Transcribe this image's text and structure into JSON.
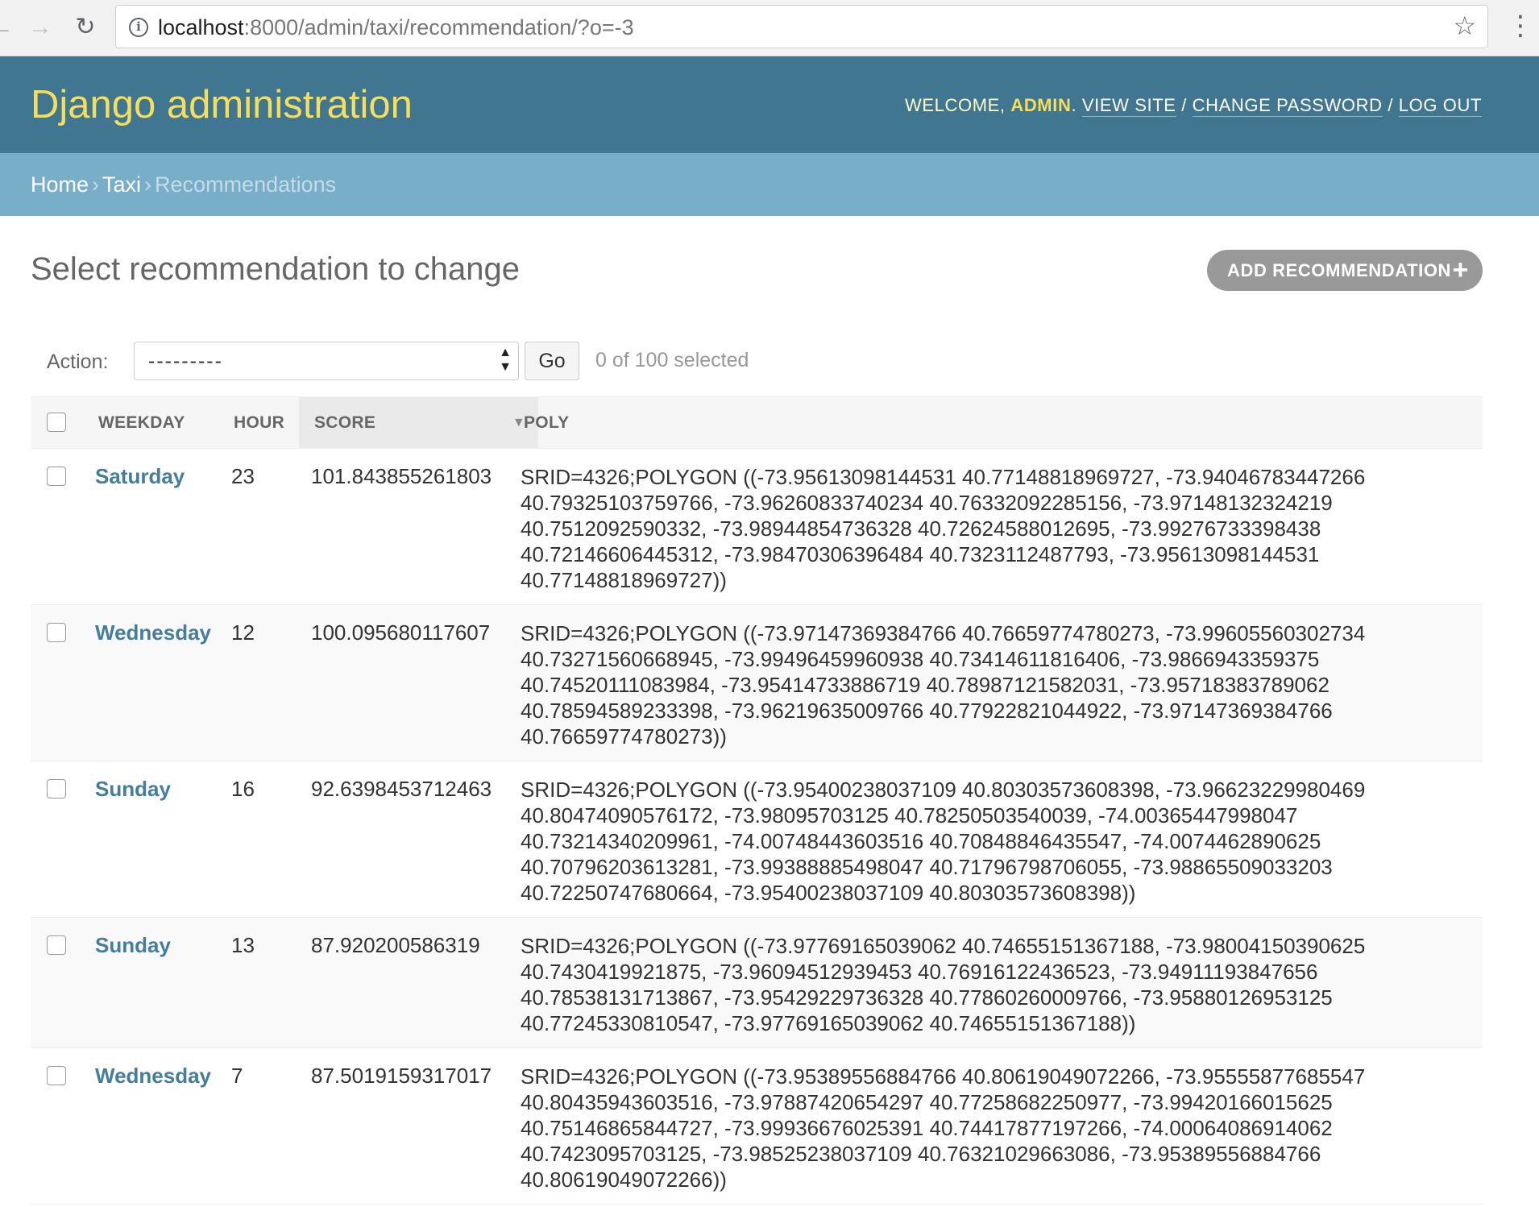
{
  "browser": {
    "url_host": "localhost",
    "url_path": ":8000/admin/taxi/recommendation/?o=-3"
  },
  "header": {
    "site_title": "Django administration",
    "welcome": "WELCOME,",
    "username": "ADMIN",
    "view_site": "VIEW SITE",
    "change_password": "CHANGE PASSWORD",
    "log_out": "LOG OUT"
  },
  "breadcrumbs": {
    "home": "Home",
    "app": "Taxi",
    "current": "Recommendations"
  },
  "page": {
    "title": "Select recommendation to change",
    "add_button": "ADD RECOMMENDATION"
  },
  "actions": {
    "label": "Action:",
    "selected_option": "---------",
    "go": "Go",
    "selected_count": "0 of 100 selected"
  },
  "table": {
    "columns": [
      "WEEKDAY",
      "HOUR",
      "SCORE",
      "POLY"
    ],
    "rows": [
      {
        "weekday": "Saturday",
        "hour": "23",
        "score": "101.843855261803",
        "poly_lines": [
          "SRID=4326;POLYGON ((-73.95613098144531 40.77148818969727, -73.94046783447266",
          "40.79325103759766, -73.96260833740234 40.76332092285156, -73.97148132324219",
          "40.7512092590332, -73.98944854736328 40.72624588012695, -73.99276733398438",
          "40.72146606445312, -73.98470306396484 40.7323112487793, -73.95613098144531",
          "40.77148818969727))"
        ]
      },
      {
        "weekday": "Wednesday",
        "hour": "12",
        "score": "100.095680117607",
        "poly_lines": [
          "SRID=4326;POLYGON ((-73.97147369384766 40.76659774780273, -73.99605560302734",
          "40.73271560668945, -73.99496459960938 40.73414611816406, -73.9866943359375",
          "40.74520111083984, -73.95414733886719 40.78987121582031, -73.95718383789062",
          "40.78594589233398, -73.96219635009766 40.77922821044922, -73.97147369384766",
          "40.76659774780273))"
        ]
      },
      {
        "weekday": "Sunday",
        "hour": "16",
        "score": "92.6398453712463",
        "poly_lines": [
          "SRID=4326;POLYGON ((-73.95400238037109 40.80303573608398, -73.96623229980469",
          "40.80474090576172, -73.98095703125 40.78250503540039, -74.00365447998047",
          "40.73214340209961, -74.00748443603516 40.70848846435547, -74.0074462890625",
          "40.70796203613281, -73.99388885498047 40.71796798706055, -73.98865509033203",
          "40.72250747680664, -73.95400238037109 40.80303573608398))"
        ]
      },
      {
        "weekday": "Sunday",
        "hour": "13",
        "score": "87.920200586319",
        "poly_lines": [
          "SRID=4326;POLYGON ((-73.97769165039062 40.74655151367188, -73.98004150390625",
          "40.7430419921875, -73.96094512939453 40.76916122436523, -73.94911193847656",
          "40.78538131713867, -73.95429229736328 40.77860260009766, -73.95880126953125",
          "40.77245330810547, -73.97769165039062 40.74655151367188))"
        ]
      },
      {
        "weekday": "Wednesday",
        "hour": "7",
        "score": "87.5019159317017",
        "poly_lines": [
          "SRID=4326;POLYGON ((-73.95389556884766 40.80619049072266, -73.95555877685547",
          "40.80435943603516, -73.97887420654297 40.77258682250977, -73.99420166015625",
          "40.75146865844727, -73.99936676025391 40.74417877197266, -74.00064086914062",
          "40.7423095703125, -73.98525238037109 40.76321029663086, -73.95389556884766",
          "40.80619049072266))"
        ]
      }
    ]
  },
  "colors": {
    "header_bg": "#417690",
    "site_title": "#f5dd5d",
    "breadcrumbs_bg": "#79aec8",
    "link": "#447e9b",
    "add_button_bg": "#999999"
  }
}
